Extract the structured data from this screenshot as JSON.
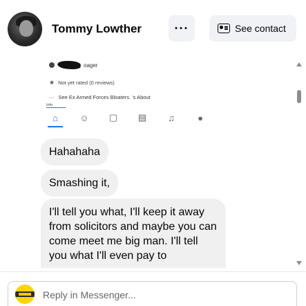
{
  "header": {
    "name": "Tommy Lowther",
    "more_label": "···",
    "see_contact_label": "See contact"
  },
  "shared_post": {
    "username_suffix": "oager",
    "rating_text": "Not yet rated (0 reviews)",
    "bio_text": "See Ex Armed Forces Bloaters. 's About",
    "info_label": "Info",
    "tabs": [
      "home-icon",
      "people-icon",
      "video-icon",
      "shop-icon",
      "bell-icon",
      "profile-icon"
    ]
  },
  "messages": [
    {
      "text": "Hahahaha"
    },
    {
      "text": "Smashing it,"
    },
    {
      "text": "I'll tell you what, I'll keep it away from solicitors and maybe you can come meet me big man. I'll tell you what I'll even pay to"
    }
  ],
  "footer": {
    "reply_placeholder": "Reply in Messenger..."
  }
}
